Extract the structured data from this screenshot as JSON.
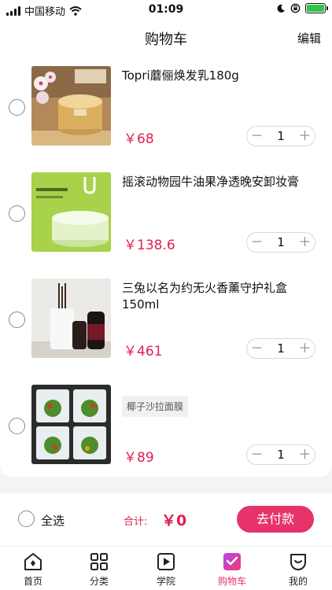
{
  "status_bar": {
    "carrier": "中国移动",
    "time": "01:09",
    "battery_color": "#36c24a"
  },
  "nav": {
    "title": "购物车",
    "edit_label": "编辑"
  },
  "cart": {
    "items": [
      {
        "name": "Topri蘑俪焕发乳180g",
        "tag": "",
        "price": "￥68",
        "quantity": "1",
        "minus": "－",
        "plus": "＋",
        "image": "cream-jar"
      },
      {
        "name": "摇滚动物园牛油果净透晚安卸妆膏",
        "tag": "",
        "price": "￥138.6",
        "quantity": "1",
        "minus": "－",
        "plus": "＋",
        "image": "cleansing-balm"
      },
      {
        "name": "三兔以名为约无火香薰守护礼盒150ml",
        "tag": "",
        "price": "￥461",
        "quantity": "1",
        "minus": "－",
        "plus": "＋",
        "image": "reed-diffuser"
      },
      {
        "name": "",
        "tag": "椰子沙拉面膜",
        "price": "￥89",
        "quantity": "1",
        "minus": "－",
        "plus": "＋",
        "image": "salad-mask"
      }
    ]
  },
  "checkout": {
    "select_all_label": "全选",
    "total_label": "合计:",
    "total_value": "￥0",
    "pay_label": "去付款",
    "accent_color": "#e6336a"
  },
  "tabbar": {
    "tabs": [
      {
        "label": "首页",
        "icon": "home-icon"
      },
      {
        "label": "分类",
        "icon": "category-icon"
      },
      {
        "label": "学院",
        "icon": "play-icon"
      },
      {
        "label": "购物车",
        "icon": "cart-icon"
      },
      {
        "label": "我的",
        "icon": "profile-icon"
      }
    ],
    "active_index": 3
  }
}
